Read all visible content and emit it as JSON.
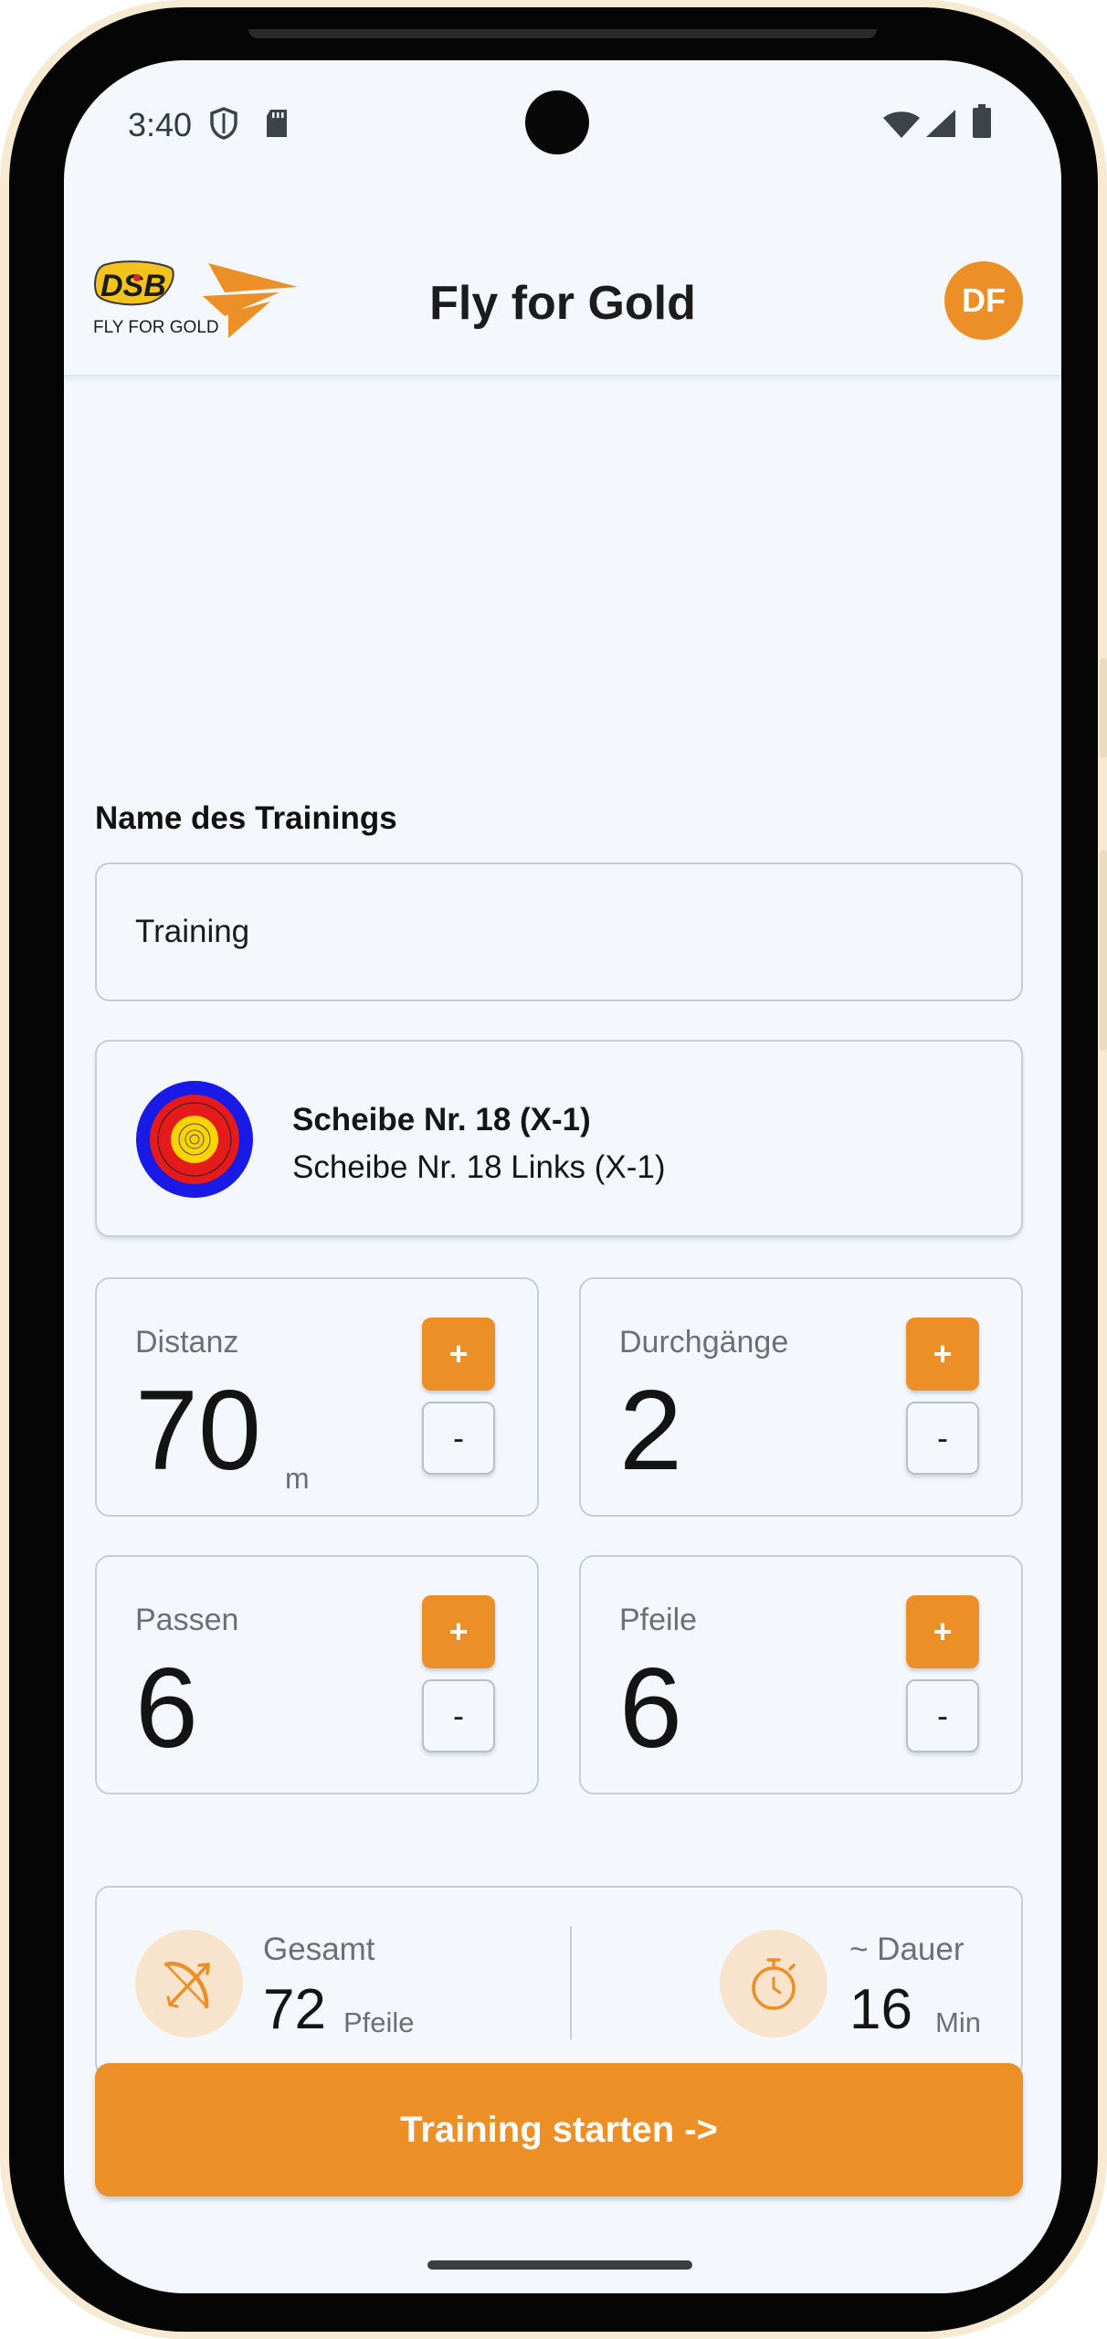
{
  "status_bar": {
    "time": "3:40",
    "left_icons": [
      "shield-icon",
      "sd-card-icon"
    ],
    "right_icons": [
      "wifi-icon",
      "cellular-signal-icon",
      "battery-icon"
    ]
  },
  "app_bar": {
    "title": "Fly for Gold",
    "logo": {
      "badge_text": "DSB",
      "caption": "FLY FOR GOLD"
    },
    "avatar_initials": "DF"
  },
  "training_name": {
    "label": "Name des Trainings",
    "value": "Training",
    "placeholder": ""
  },
  "target": {
    "title": "Scheibe Nr. 18 (X-1)",
    "subtitle": "Scheibe Nr. 18 Links (X-1)",
    "icon": "target-face-icon"
  },
  "settings": {
    "distance": {
      "label": "Distanz",
      "value": "70",
      "unit": "m"
    },
    "rounds": {
      "label": "Durchgänge",
      "value": "2"
    },
    "ends": {
      "label": "Passen",
      "value": "6"
    },
    "arrows": {
      "label": "Pfeile",
      "value": "6"
    },
    "increment_label": "+",
    "decrement_label": "-"
  },
  "summary": {
    "total": {
      "label": "Gesamt",
      "value": "72",
      "unit": "Pfeile",
      "icon": "bow-arrow-icon"
    },
    "duration": {
      "label": "~ Dauer",
      "value": "16",
      "unit": "Min",
      "icon": "stopwatch-icon"
    }
  },
  "start_button_label": "Training starten ->",
  "colors": {
    "accent": "#EC8F26",
    "accent_light": "#F8E4CD",
    "background": "#F4F8FC",
    "text": "#141414",
    "muted_text": "#6C6F73",
    "border": "#C8CED4"
  }
}
